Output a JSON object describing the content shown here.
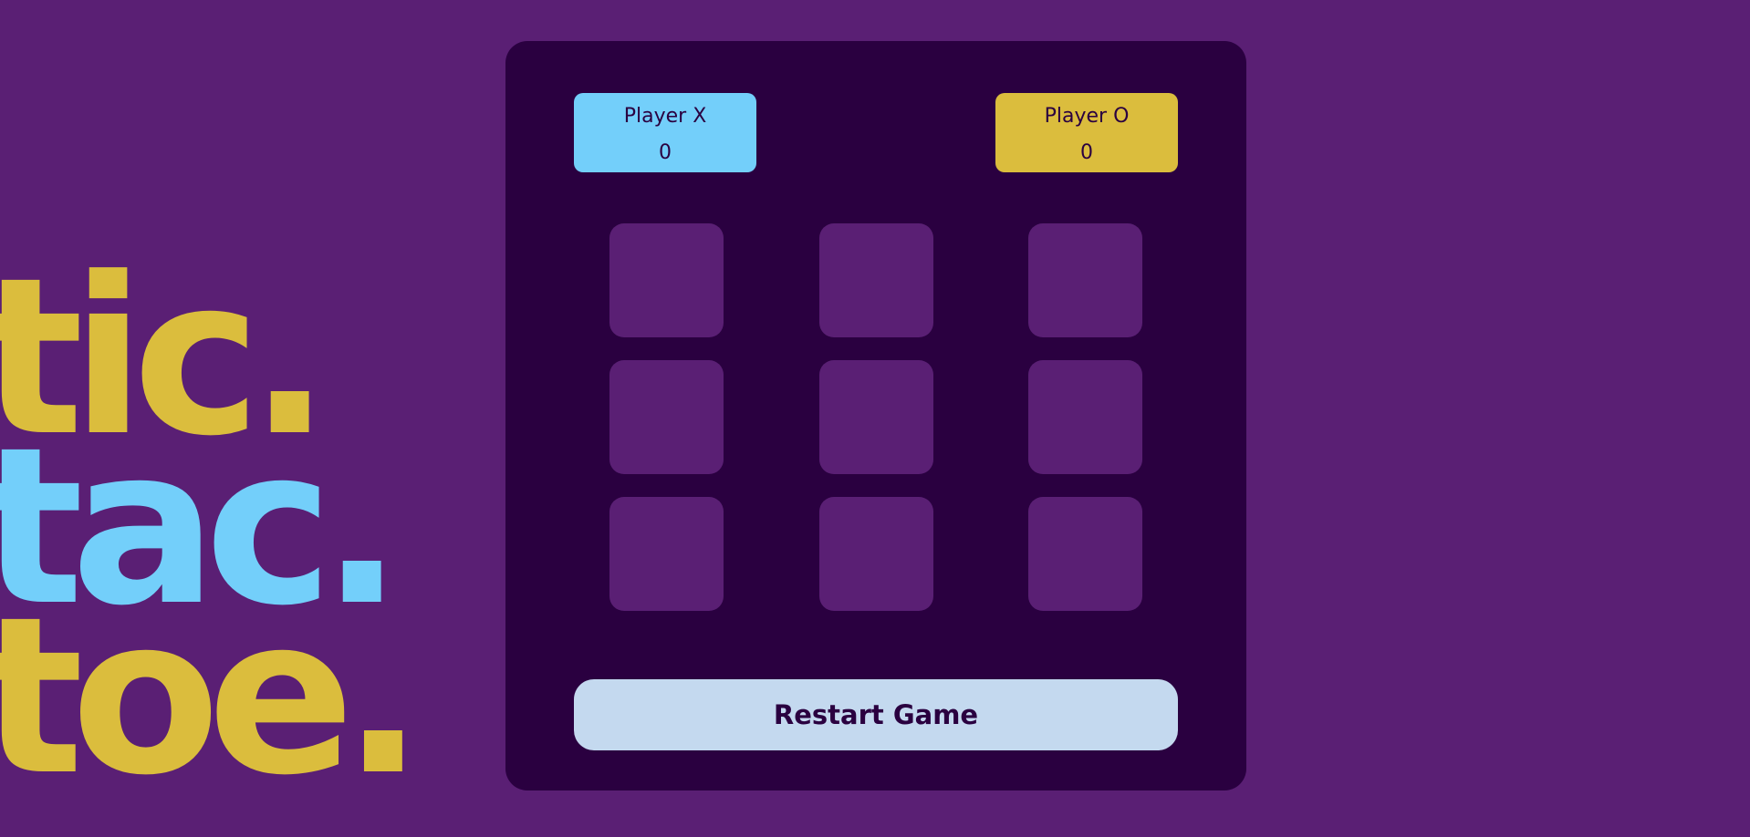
{
  "logo": {
    "line1": "tic.",
    "line2": "tac.",
    "line3": "toe."
  },
  "players": {
    "x": {
      "name": "Player X",
      "score": "0"
    },
    "o": {
      "name": "Player O",
      "score": "0"
    }
  },
  "board": {
    "cells": [
      "",
      "",
      "",
      "",
      "",
      "",
      "",
      "",
      ""
    ]
  },
  "controls": {
    "restart_label": "Restart Game"
  },
  "colors": {
    "background": "#5a1f74",
    "panel": "#2a0040",
    "player_x": "#73cffa",
    "player_o": "#dbbd3d",
    "cell": "#5a1f74",
    "restart": "#c4d9ef"
  }
}
